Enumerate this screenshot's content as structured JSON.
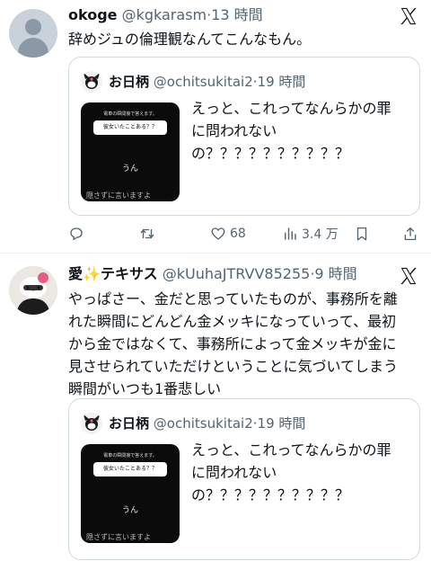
{
  "tweet1": {
    "display_name": "okoge",
    "handle": "@kgkarasm",
    "dot": "·",
    "time": "13 時間",
    "text_lines": [
      "辞めジュの倫理観なんてこんなもん。"
    ],
    "quote": {
      "display_name": "お日柄",
      "handle": "@ochitsukitai2",
      "dot": "·",
      "time": "19 時間",
      "text_lines": [
        "えっと、これってなんらかの罪",
        "に問われない",
        "の？？？？？？？？？？"
      ],
      "thumb": {
        "top_label": "電車の瞬間接で答えます。",
        "question": "彼女いたことある？？",
        "answer": "うん",
        "cut_text": "隠さずに言いますよ"
      }
    },
    "actions": {
      "reply_icon": "reply-icon",
      "retweet_icon": "retweet-icon",
      "like_icon": "heart-icon",
      "like_count": "68",
      "views_icon": "views-icon",
      "views_count": "3.4 万",
      "bookmark_icon": "bookmark-icon",
      "share_icon": "share-icon"
    }
  },
  "tweet2": {
    "display_name_prefix": "愛",
    "display_name_emoji": "✨",
    "display_name_suffix": "テキサス",
    "handle": "@kUuhaJTRVV85255",
    "dot": "·",
    "time": "9 時間",
    "text_lines": [
      "やっぱさー、金だと思っていたものが、事務所を離",
      "れた瞬間にどんどん金メッキになっていって、最初",
      "から金ではなくて、事務所によって金メッキが金に",
      "見させられていただけということに気づいてしまう",
      "瞬間がいつも1番悲しい"
    ],
    "quote": {
      "display_name": "お日柄",
      "handle": "@ochitsukitai2",
      "dot": "·",
      "time": "19 時間",
      "text_lines": [
        "えっと、これってなんらかの罪",
        "に問われない",
        "の？？？？？？？？？？"
      ],
      "thumb": {
        "top_label": "電車の瞬間接で答えます。",
        "question": "彼女いたことある？？",
        "answer": "うん",
        "cut_text": "隠さずに言いますよ"
      }
    }
  },
  "colors": {
    "text": "#0f1419",
    "secondary": "#536471",
    "border": "#cfd9de",
    "divider": "#eff3f4"
  }
}
